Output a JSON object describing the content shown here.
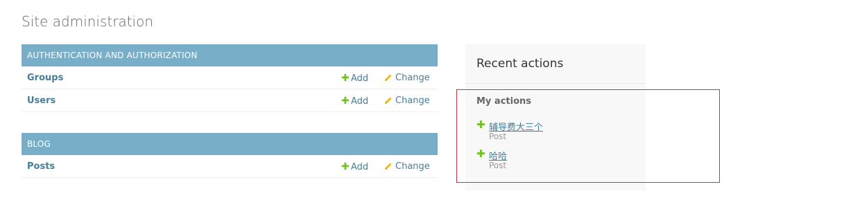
{
  "page": {
    "title": "Site administration"
  },
  "modules": [
    {
      "caption": "AUTHENTICATION AND AUTHORIZATION",
      "rows": [
        {
          "model": "Groups",
          "add_label": "Add",
          "change_label": "Change"
        },
        {
          "model": "Users",
          "add_label": "Add",
          "change_label": "Change"
        }
      ]
    },
    {
      "caption": "BLOG",
      "rows": [
        {
          "model": "Posts",
          "add_label": "Add",
          "change_label": "Change"
        }
      ]
    }
  ],
  "recent_actions": {
    "title": "Recent actions",
    "section_label": "My actions",
    "items": [
      {
        "title": "辅导费大三个",
        "type": "Post",
        "action_icon": "addlink-plus-icon"
      },
      {
        "title": "哈哈",
        "type": "Post",
        "action_icon": "addlink-plus-icon"
      }
    ]
  },
  "icons": {
    "add": "plus-icon",
    "change": "pencil-icon"
  },
  "colors": {
    "module_header": "#79aec8",
    "link": "#447e9b",
    "add_green": "#70bf2b",
    "change_yellow": "#efb80b",
    "highlight_red": "#d0313f",
    "sidebar_bg": "#f8f8f8"
  }
}
